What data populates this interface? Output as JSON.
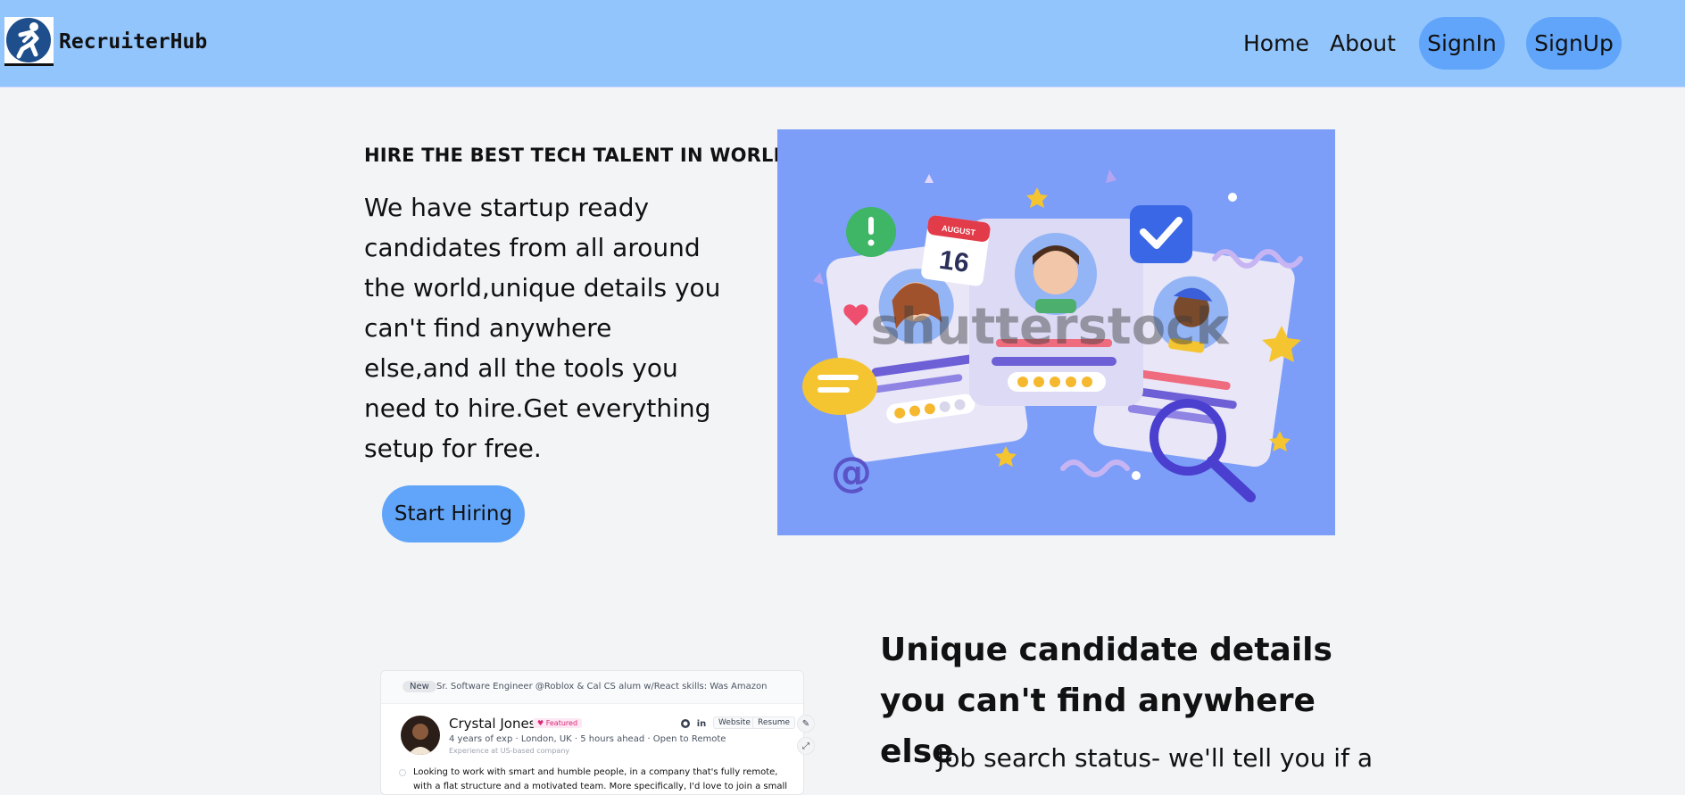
{
  "brand": {
    "name": "RecruiterHub",
    "logo_icon": "runner-logo-icon"
  },
  "nav": {
    "links": [
      "Home",
      "About"
    ],
    "signin": "SignIn",
    "signup": "SignUp"
  },
  "hero": {
    "eyebrow": "HIRE THE BEST TECH TALENT IN WORLD",
    "body": "We have startup ready candidates from all around the world,unique details you can't find anywhere else,and all the tools you need to hire.Get everything setup for free.",
    "cta": "Start Hiring",
    "illustration": {
      "calendar_month": "AUGUST",
      "calendar_day": "16",
      "watermark": "shutterstock"
    }
  },
  "feature": {
    "title": "Unique candidate details you can't find anywhere else",
    "body": "Job search status- we'll tell you if a"
  },
  "profile_card": {
    "badge": "New",
    "headline": "Sr. Software Engineer @Roblox & Cal CS alum w/React skills: Was Amazon",
    "name": "Crystal Jones",
    "featured": "♥ Featured",
    "meta": "4 years of exp · London, UK · 5 hours ahead · Open to Remote",
    "sub": "Experience at US-based company",
    "links": [
      "Website",
      "Resume"
    ],
    "bio": "Looking to work with smart and humble people, in a company that's fully remote, with a flat structure and a motivated team. More specifically, I'd love to join a small team and be a key"
  },
  "colors": {
    "nav_bg": "#93c5fd",
    "pill": "#60a5fa",
    "page_bg": "#f3f4f6",
    "illustration_bg": "#7c9ef8"
  }
}
